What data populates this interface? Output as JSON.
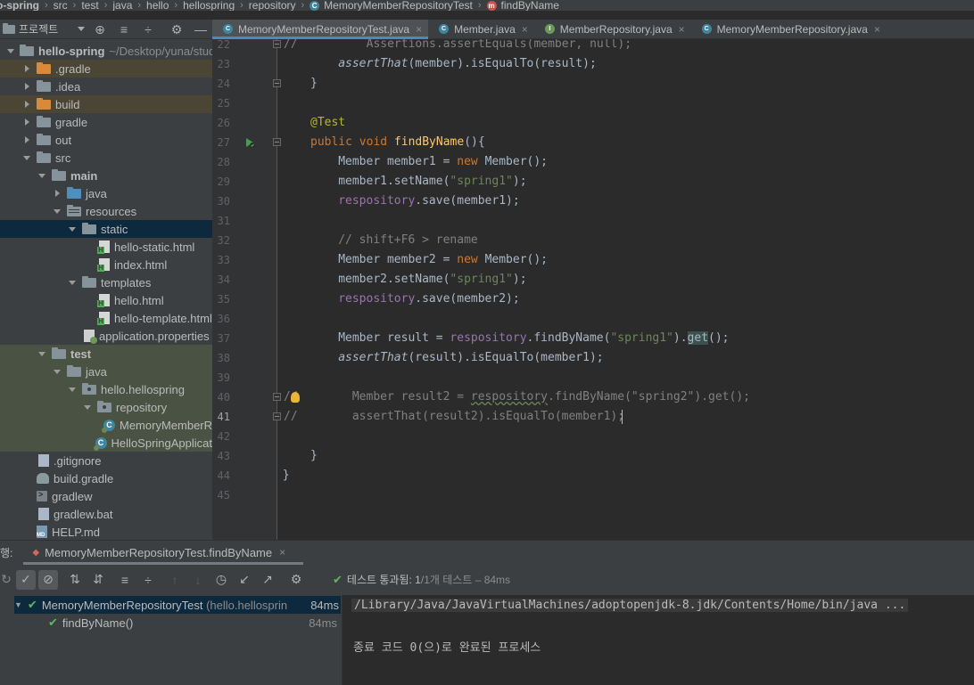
{
  "breadcrumb": [
    "o-spring",
    "src",
    "test",
    "java",
    "hello",
    "hellospring",
    "repository",
    "MemoryMemberRepositoryTest",
    "findByName"
  ],
  "project_panel": {
    "title": "프로젝트"
  },
  "tree": [
    {
      "label": "hello-spring",
      "extra": "~/Desktop/yuna/stud",
      "bold": true,
      "arrow": "d",
      "depth": 0,
      "icon": "fold",
      "color": "#87939a"
    },
    {
      "label": ".gradle",
      "arrow": "r",
      "depth": 1,
      "icon": "fold orange",
      "bg": "brn"
    },
    {
      "label": ".idea",
      "arrow": "r",
      "depth": 1,
      "icon": "fold"
    },
    {
      "label": "build",
      "arrow": "r",
      "depth": 1,
      "icon": "fold orange",
      "bg": "brn"
    },
    {
      "label": "gradle",
      "arrow": "r",
      "depth": 1,
      "icon": "fold"
    },
    {
      "label": "out",
      "arrow": "r",
      "depth": 1,
      "icon": "fold"
    },
    {
      "label": "src",
      "arrow": "d",
      "depth": 1,
      "icon": "fold"
    },
    {
      "label": "main",
      "bold": true,
      "arrow": "d",
      "depth": 2,
      "icon": "fold"
    },
    {
      "label": "java",
      "arrow": "r",
      "depth": 3,
      "icon": "fold blue"
    },
    {
      "label": "resources",
      "arrow": "d",
      "depth": 3,
      "icon": "fold res"
    },
    {
      "label": "static",
      "arrow": "d",
      "depth": 4,
      "icon": "fold",
      "bg": "sel"
    },
    {
      "label": "hello-static.html",
      "arrow": "n",
      "depth": 5,
      "icon": "html"
    },
    {
      "label": "index.html",
      "arrow": "n",
      "depth": 5,
      "icon": "html"
    },
    {
      "label": "templates",
      "arrow": "d",
      "depth": 4,
      "icon": "fold"
    },
    {
      "label": "hello.html",
      "arrow": "n",
      "depth": 5,
      "icon": "html"
    },
    {
      "label": "hello-template.html",
      "arrow": "n",
      "depth": 5,
      "icon": "html"
    },
    {
      "label": "application.properties",
      "arrow": "n",
      "depth": 4,
      "icon": "prop"
    },
    {
      "label": "test",
      "bold": true,
      "arrow": "d",
      "depth": 2,
      "icon": "fold",
      "bg": "grn"
    },
    {
      "label": "java",
      "arrow": "d",
      "depth": 3,
      "icon": "fold",
      "bg": "grn"
    },
    {
      "label": "hello.hellospring",
      "arrow": "d",
      "depth": 4,
      "icon": "fold pkg",
      "bg": "grn"
    },
    {
      "label": "repository",
      "arrow": "d",
      "depth": 5,
      "icon": "fold pkg",
      "bg": "grn"
    },
    {
      "label": "MemoryMemberR",
      "arrow": "n",
      "depth": 6,
      "icon": "java test",
      "bg": "grn"
    },
    {
      "label": "HelloSpringApplicat",
      "arrow": "n",
      "depth": 5,
      "icon": "java test",
      "bg": "grn"
    },
    {
      "label": ".gitignore",
      "arrow": "n",
      "depth": 1,
      "icon": "doc"
    },
    {
      "label": "build.gradle",
      "arrow": "n",
      "depth": 1,
      "icon": "gradlefile"
    },
    {
      "label": "gradlew",
      "arrow": "n",
      "depth": 1,
      "icon": "term"
    },
    {
      "label": "gradlew.bat",
      "arrow": "n",
      "depth": 1,
      "icon": "doc"
    },
    {
      "label": "HELP.md",
      "arrow": "n",
      "depth": 1,
      "icon": "md"
    }
  ],
  "tabs": [
    {
      "label": "MemoryMemberRepositoryTest.java",
      "active": true,
      "color": "#3e86a0",
      "letter": "C"
    },
    {
      "label": "Member.java",
      "color": "#3e86a0",
      "letter": "C"
    },
    {
      "label": "MemberRepository.java",
      "color": "#6a9a57",
      "letter": "I"
    },
    {
      "label": "MemoryMemberRepository.java",
      "color": "#3e86a0",
      "letter": "C"
    }
  ],
  "editor": {
    "lines": [
      {
        "n": "22",
        "html": "<span class=\"gray\">        Assertions.assertEquals(member, null);</span>",
        "mark": "//"
      },
      {
        "n": "23",
        "html": "<span class=\"it\">assertThat</span>(member).isEqualTo(result);",
        "indent": 4
      },
      {
        "n": "24",
        "html": "}",
        "indent": 0
      },
      {
        "n": "25",
        "html": ""
      },
      {
        "n": "26",
        "html": "<span class=\"ann\">@Test</span>",
        "indent": 0
      },
      {
        "n": "27",
        "html": "<span class=\"kw\">public void </span><span class=\"fn\">findByName</span>(){",
        "indent": 0
      },
      {
        "n": "28",
        "html": "Member member1 = <span class=\"kw\">new </span>Member();",
        "indent": 4
      },
      {
        "n": "29",
        "html": "member1.setName(<span class=\"str\">\"spring1\"</span>);",
        "indent": 4
      },
      {
        "n": "30",
        "html": "<span class=\"fld\">respository</span>.save(member1);",
        "indent": 4
      },
      {
        "n": "31",
        "html": ""
      },
      {
        "n": "32",
        "html": "<span class=\"cm\">// shift+F6 &gt; rename</span>",
        "indent": 4
      },
      {
        "n": "33",
        "html": "Member member2 = <span class=\"kw\">new </span>Member();",
        "indent": 4
      },
      {
        "n": "34",
        "html": "member2.setName(<span class=\"str\">\"spring1\"</span>);",
        "indent": 4
      },
      {
        "n": "35",
        "html": "<span class=\"fld\">respository</span>.save(member2);",
        "indent": 4
      },
      {
        "n": "36",
        "html": ""
      },
      {
        "n": "37",
        "html": "Member result = <span class=\"fld\">respository</span>.findByName(<span class=\"str\">\"spring1\"</span>).<span class=\"hl\">get</span>();",
        "indent": 4
      },
      {
        "n": "38",
        "html": "<span class=\"it\">assertThat</span>(result).isEqualTo(member1);",
        "indent": 4
      },
      {
        "n": "39",
        "html": ""
      },
      {
        "n": "40",
        "html": "<span class=\"gray\">  Member result2 = <span class=\"under\">respository</span>.findByName(\"spring2\").get();</span>",
        "indent": 4,
        "mark": "//"
      },
      {
        "n": "41",
        "html": "<span class=\"gray\">  assertThat(result2).isEqualTo(member1);</span>",
        "indent": 4,
        "mark": "//",
        "cur": true
      },
      {
        "n": "42",
        "html": ""
      },
      {
        "n": "43",
        "html": "}",
        "indent": 0
      },
      {
        "n": "44",
        "html": "}",
        "indent": -4
      },
      {
        "n": "45",
        "html": ""
      }
    ]
  },
  "run": {
    "label": "행:",
    "tab": "MemoryMemberRepositoryTest.findByName",
    "status": "테스트 통과됨:",
    "status_count": "1",
    "status_rest": "/1개 테스트 – 84ms",
    "tests": [
      {
        "name": "MemoryMemberRepositoryTest",
        "pkg": "(hello.hellosprin",
        "time": "84ms"
      },
      {
        "name": "findByName()",
        "time": "84ms"
      }
    ],
    "console": [
      "/Library/Java/JavaVirtualMachines/adoptopenjdk-8.jdk/Contents/Home/bin/java ...",
      "",
      "종료 코드 0(으)로 완료된 프로세스"
    ]
  }
}
